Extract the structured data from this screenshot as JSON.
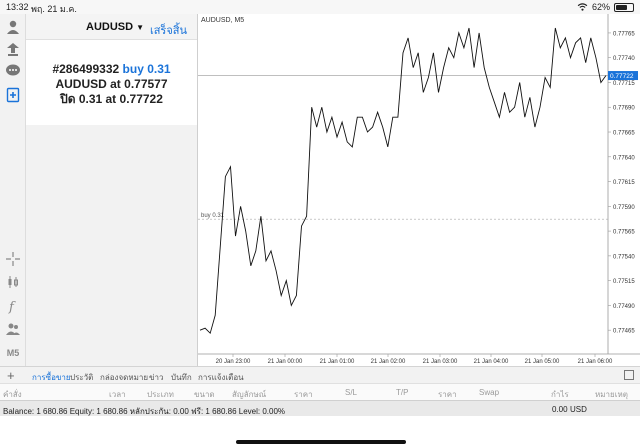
{
  "status_bar": {
    "time": "13:32",
    "date": "พฤ. 21 ม.ค.",
    "battery": "62%"
  },
  "order_panel": {
    "symbol": "AUDUSD",
    "done_label": "เสร็จสิ้น",
    "order_id": "#286499332",
    "order_action": "buy 0.31",
    "open_symbol": "AUDUSD at",
    "open_price": "0.77577",
    "close_label": "ปิด 0.31 at",
    "close_price": "0.77722"
  },
  "toolbar": {
    "timeframe": "M5",
    "icons": [
      "user-icon",
      "accounts-icon",
      "chat-icon",
      "new-order-icon",
      "crosshair-icon",
      "candles-icon",
      "indicator-icon",
      "people-icon"
    ]
  },
  "chart": {
    "title": "AUDUSD, M5",
    "current_price_label": "0.77722",
    "trade_label": "buy 0.31",
    "accent_color": "#1a73d9",
    "price_line_color": "#999999"
  },
  "chart_data": {
    "type": "line",
    "title": "AUDUSD, M5",
    "x_ticks": [
      "20 Jan 23:00",
      "21 Jan 00:00",
      "21 Jan 01:00",
      "21 Jan 02:00",
      "21 Jan 03:00",
      "21 Jan 04:00",
      "21 Jan 05:00",
      "21 Jan 06:00"
    ],
    "y_ticks": [
      "0.77765",
      "0.77740",
      "0.77715",
      "0.77690",
      "0.77665",
      "0.77640",
      "0.77615",
      "0.77590",
      "0.77565",
      "0.77540",
      "0.77515",
      "0.77490",
      "0.77465"
    ],
    "ylim": [
      0.77445,
      0.77772
    ],
    "current_price": 0.77722,
    "trade_price": 0.77577,
    "series": [
      {
        "values": [
          0.77465,
          0.77467,
          0.77462,
          0.7748,
          0.7755,
          0.7762,
          0.7763,
          0.7756,
          0.7759,
          0.77565,
          0.7753,
          0.77545,
          0.7758,
          0.77535,
          0.77545,
          0.77525,
          0.775,
          0.77515,
          0.7749,
          0.775,
          0.7757,
          0.7758,
          0.7769,
          0.7767,
          0.7769,
          0.77665,
          0.7768,
          0.7766,
          0.77675,
          0.77655,
          0.7765,
          0.7768,
          0.7768,
          0.77665,
          0.7767,
          0.77685,
          0.7767,
          0.7765,
          0.7768,
          0.7768,
          0.77745,
          0.7776,
          0.7773,
          0.77745,
          0.77705,
          0.7772,
          0.77745,
          0.77705,
          0.7773,
          0.7775,
          0.7774,
          0.77765,
          0.7775,
          0.7777,
          0.7773,
          0.77765,
          0.7773,
          0.7771,
          0.77695,
          0.7768,
          0.77705,
          0.77685,
          0.7769,
          0.77715,
          0.7768,
          0.777,
          0.7767,
          0.7769,
          0.7772,
          0.7771,
          0.7777,
          0.7775,
          0.7776,
          0.7774,
          0.77755,
          0.7776,
          0.77735,
          0.7776,
          0.7774,
          0.77715,
          0.77722
        ]
      }
    ],
    "grid": false
  },
  "tabs": {
    "plus": "+",
    "items": [
      "การซื้อขาย",
      "ประวัติ",
      "กล่องจดหมาย",
      "ข่าว",
      "บันทึก",
      "การแจ้งเตือน"
    ],
    "active": 0
  },
  "columns": [
    "คำสั่ง",
    "เวลา",
    "ประเภท",
    "ขนาด",
    "สัญลักษณ์",
    "ราคา",
    "S/L",
    "T/P",
    "ราคา",
    "Swap",
    "กำไร",
    "หมายเหตุ"
  ],
  "balance": {
    "text": "Balance: 1 680.86 Equity: 1 680.86 หลักประกัน: 0.00 ฟรี: 1 680.86 Level: 0.00%",
    "amount": "0.00",
    "currency": "USD"
  }
}
